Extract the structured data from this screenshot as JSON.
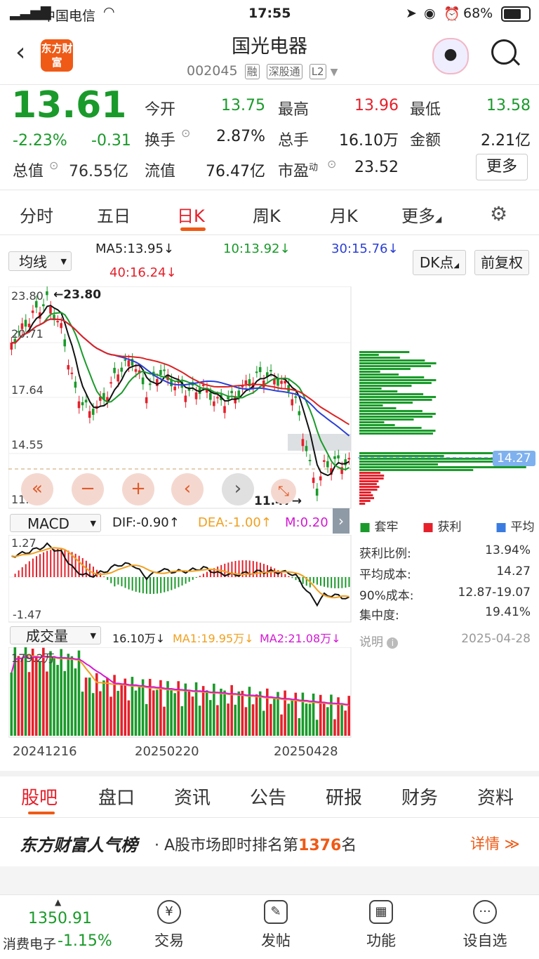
{
  "status_bar": {
    "carrier": "中国电信",
    "time": "17:55",
    "battery": "68%"
  },
  "header": {
    "logo_text": "东方财富",
    "title": "国光电器",
    "code": "002045",
    "tags": [
      "融",
      "深股通",
      "L2"
    ]
  },
  "quote": {
    "price": "13.61",
    "change_pct": "-2.23%",
    "change": "-0.31",
    "open_label": "今开",
    "open": "13.75",
    "high_label": "最高",
    "high": "13.96",
    "low_label": "最低",
    "low": "13.58",
    "turnover_label": "换手",
    "turnover": "2.87%",
    "volume_label": "总手",
    "volume": "16.10万",
    "amount_label": "金额",
    "amount": "2.21亿",
    "mcap_label": "总值",
    "mcap": "76.55亿",
    "float_label": "流值",
    "float": "76.47亿",
    "pe_label": "市盈",
    "pe_sup": "动",
    "pe": "23.52",
    "more": "更多"
  },
  "tabs": [
    "分时",
    "五日",
    "日K",
    "周K",
    "月K",
    "更多"
  ],
  "active_tab": 2,
  "chart_header": {
    "ma_select": "均线",
    "ma5": "MA5:13.95↓",
    "ma10": "10:13.92↓",
    "ma30": "30:15.76↓",
    "ma40": "40:16.24↓",
    "dk_btn": "DK点",
    "adjust_btn": "前复权"
  },
  "kline": {
    "y_labels": [
      "23.80",
      "20.71",
      "17.64",
      "14.55",
      "11.47"
    ],
    "max_label": "23.80",
    "min_label": "11.47",
    "price_line": "14.27"
  },
  "macd": {
    "select": "MACD",
    "dif": "DIF:-0.90↑",
    "dea": "DEA:-1.00↑",
    "m": "M:0.20",
    "top_label": "1.27",
    "bottom_label": "-1.47"
  },
  "volume": {
    "select": "成交量",
    "vol": "16.10万↓",
    "ma1": "MA1:19.95万↓",
    "ma2": "MA2:21.08万↓",
    "top_label": "179.2万",
    "dates": [
      "20241216",
      "20250220",
      "20250428"
    ]
  },
  "chip_panel": {
    "legend": [
      "套牢",
      "获利",
      "平均"
    ],
    "rows": [
      {
        "label": "获利比例:",
        "value": "13.94%"
      },
      {
        "label": "平均成本:",
        "value": "14.27"
      },
      {
        "label": "90%成本:",
        "value": "12.87-19.07"
      },
      {
        "label": "集中度:",
        "value": "19.41%"
      }
    ],
    "note_label": "说明",
    "date": "2025-04-28"
  },
  "sub_tabs": [
    "股吧",
    "盘口",
    "资讯",
    "公告",
    "研报",
    "财务",
    "资料"
  ],
  "rank": {
    "brand": "东方财富人气榜",
    "text_prefix": "A股市场即时排名第",
    "rank": "1376",
    "text_suffix": "名",
    "detail": "详情"
  },
  "bottom_bar": {
    "index_value": "1350.91",
    "index_name": "消费电子",
    "index_change": "-1.15%",
    "items": [
      "交易",
      "发帖",
      "功能",
      "设自选"
    ]
  },
  "colors": {
    "up": "#e5202b",
    "down": "#1a9a2a",
    "accent": "#ef5a16"
  }
}
